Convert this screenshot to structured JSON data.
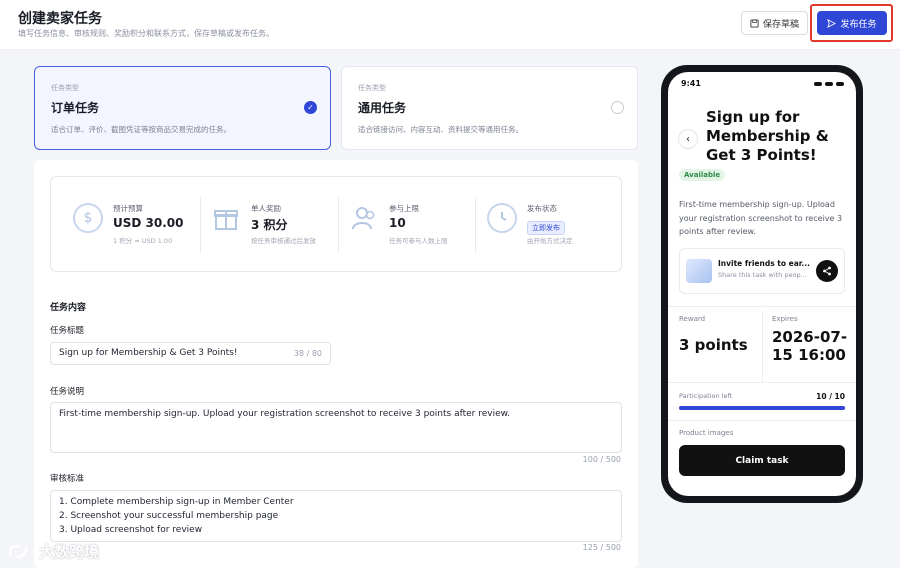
{
  "header": {
    "title": "创建卖家任务",
    "subtitle": "填写任务信息、审核规则、奖励积分和联系方式，保存草稿或发布任务。",
    "save_draft": "保存草稿",
    "publish": "发布任务"
  },
  "task_types": [
    {
      "tag": "任务类型",
      "name": "订单任务",
      "desc": "适合订单、评价、截图凭证等按商品交易完成的任务。",
      "selected": true
    },
    {
      "tag": "任务类型",
      "name": "通用任务",
      "desc": "适合链接访问、内容互动、资料提交等通用任务。",
      "selected": false
    }
  ],
  "stats": {
    "budget": {
      "label": "预计预算",
      "value": "USD 30.00",
      "note": "1 积分 ≈ USD 1.00",
      "icon": "dollar-icon"
    },
    "reward": {
      "label": "单人奖励",
      "value": "3 积分",
      "note": "按任务审核通过后发放",
      "icon": "gift-icon"
    },
    "limit": {
      "label": "参与上限",
      "value": "10",
      "note": "任务可参与人数上限",
      "icon": "users-icon"
    },
    "status": {
      "label": "发布状态",
      "badge": "立即发布",
      "note": "由开始方式决定",
      "icon": "clock-icon"
    }
  },
  "form": {
    "section_title": "任务内容",
    "title_label": "任务标题",
    "title_value": "Sign up for Membership & Get 3 Points!",
    "title_counter": "38 / 80",
    "desc_label": "任务说明",
    "desc_value": "First-time membership sign-up. Upload your registration screenshot to receive 3 points after review.",
    "desc_counter": "100 / 500",
    "criteria_label": "审核标准",
    "criteria_lines": [
      "1. Complete membership sign-up in Member Center",
      "2. Screenshot your successful membership page",
      "3. Upload screenshot for review"
    ],
    "criteria_counter": "125 / 500"
  },
  "preview": {
    "time": "9:41",
    "title": "Sign up for Membership & Get 3 Points!",
    "badge": "Available",
    "description": "First-time membership sign-up. Upload your registration screenshot to receive 3 points after review.",
    "invite_title": "Invite friends to ear...",
    "invite_sub": "Share this task with peop...",
    "reward_label": "Reward",
    "reward_value": "3 points",
    "expires_label": "Expires",
    "expires_value": "2026-07-15 16:00",
    "participation_label": "Participation left",
    "participation_value": "10 / 10",
    "participation_fraction": 1.0,
    "images_label": "Product images",
    "claim_button": "Claim task"
  },
  "watermark": "大数跨境",
  "colors": {
    "accent": "#2f47d6",
    "highlight_border": "#e2372b",
    "available": "#2e8b49"
  }
}
